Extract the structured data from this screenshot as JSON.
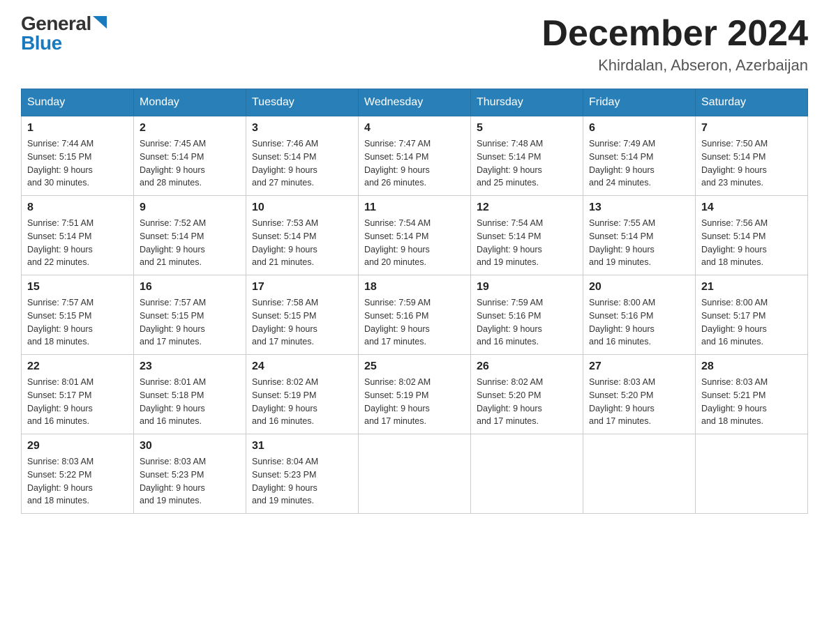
{
  "logo": {
    "general": "General",
    "blue": "Blue"
  },
  "title": {
    "month": "December 2024",
    "location": "Khirdalan, Abseron, Azerbaijan"
  },
  "weekdays": [
    "Sunday",
    "Monday",
    "Tuesday",
    "Wednesday",
    "Thursday",
    "Friday",
    "Saturday"
  ],
  "weeks": [
    [
      {
        "day": "1",
        "sunrise": "7:44 AM",
        "sunset": "5:15 PM",
        "daylight": "9 hours and 30 minutes."
      },
      {
        "day": "2",
        "sunrise": "7:45 AM",
        "sunset": "5:14 PM",
        "daylight": "9 hours and 28 minutes."
      },
      {
        "day": "3",
        "sunrise": "7:46 AM",
        "sunset": "5:14 PM",
        "daylight": "9 hours and 27 minutes."
      },
      {
        "day": "4",
        "sunrise": "7:47 AM",
        "sunset": "5:14 PM",
        "daylight": "9 hours and 26 minutes."
      },
      {
        "day": "5",
        "sunrise": "7:48 AM",
        "sunset": "5:14 PM",
        "daylight": "9 hours and 25 minutes."
      },
      {
        "day": "6",
        "sunrise": "7:49 AM",
        "sunset": "5:14 PM",
        "daylight": "9 hours and 24 minutes."
      },
      {
        "day": "7",
        "sunrise": "7:50 AM",
        "sunset": "5:14 PM",
        "daylight": "9 hours and 23 minutes."
      }
    ],
    [
      {
        "day": "8",
        "sunrise": "7:51 AM",
        "sunset": "5:14 PM",
        "daylight": "9 hours and 22 minutes."
      },
      {
        "day": "9",
        "sunrise": "7:52 AM",
        "sunset": "5:14 PM",
        "daylight": "9 hours and 21 minutes."
      },
      {
        "day": "10",
        "sunrise": "7:53 AM",
        "sunset": "5:14 PM",
        "daylight": "9 hours and 21 minutes."
      },
      {
        "day": "11",
        "sunrise": "7:54 AM",
        "sunset": "5:14 PM",
        "daylight": "9 hours and 20 minutes."
      },
      {
        "day": "12",
        "sunrise": "7:54 AM",
        "sunset": "5:14 PM",
        "daylight": "9 hours and 19 minutes."
      },
      {
        "day": "13",
        "sunrise": "7:55 AM",
        "sunset": "5:14 PM",
        "daylight": "9 hours and 19 minutes."
      },
      {
        "day": "14",
        "sunrise": "7:56 AM",
        "sunset": "5:14 PM",
        "daylight": "9 hours and 18 minutes."
      }
    ],
    [
      {
        "day": "15",
        "sunrise": "7:57 AM",
        "sunset": "5:15 PM",
        "daylight": "9 hours and 18 minutes."
      },
      {
        "day": "16",
        "sunrise": "7:57 AM",
        "sunset": "5:15 PM",
        "daylight": "9 hours and 17 minutes."
      },
      {
        "day": "17",
        "sunrise": "7:58 AM",
        "sunset": "5:15 PM",
        "daylight": "9 hours and 17 minutes."
      },
      {
        "day": "18",
        "sunrise": "7:59 AM",
        "sunset": "5:16 PM",
        "daylight": "9 hours and 17 minutes."
      },
      {
        "day": "19",
        "sunrise": "7:59 AM",
        "sunset": "5:16 PM",
        "daylight": "9 hours and 16 minutes."
      },
      {
        "day": "20",
        "sunrise": "8:00 AM",
        "sunset": "5:16 PM",
        "daylight": "9 hours and 16 minutes."
      },
      {
        "day": "21",
        "sunrise": "8:00 AM",
        "sunset": "5:17 PM",
        "daylight": "9 hours and 16 minutes."
      }
    ],
    [
      {
        "day": "22",
        "sunrise": "8:01 AM",
        "sunset": "5:17 PM",
        "daylight": "9 hours and 16 minutes."
      },
      {
        "day": "23",
        "sunrise": "8:01 AM",
        "sunset": "5:18 PM",
        "daylight": "9 hours and 16 minutes."
      },
      {
        "day": "24",
        "sunrise": "8:02 AM",
        "sunset": "5:19 PM",
        "daylight": "9 hours and 16 minutes."
      },
      {
        "day": "25",
        "sunrise": "8:02 AM",
        "sunset": "5:19 PM",
        "daylight": "9 hours and 17 minutes."
      },
      {
        "day": "26",
        "sunrise": "8:02 AM",
        "sunset": "5:20 PM",
        "daylight": "9 hours and 17 minutes."
      },
      {
        "day": "27",
        "sunrise": "8:03 AM",
        "sunset": "5:20 PM",
        "daylight": "9 hours and 17 minutes."
      },
      {
        "day": "28",
        "sunrise": "8:03 AM",
        "sunset": "5:21 PM",
        "daylight": "9 hours and 18 minutes."
      }
    ],
    [
      {
        "day": "29",
        "sunrise": "8:03 AM",
        "sunset": "5:22 PM",
        "daylight": "9 hours and 18 minutes."
      },
      {
        "day": "30",
        "sunrise": "8:03 AM",
        "sunset": "5:23 PM",
        "daylight": "9 hours and 19 minutes."
      },
      {
        "day": "31",
        "sunrise": "8:04 AM",
        "sunset": "5:23 PM",
        "daylight": "9 hours and 19 minutes."
      },
      null,
      null,
      null,
      null
    ]
  ]
}
